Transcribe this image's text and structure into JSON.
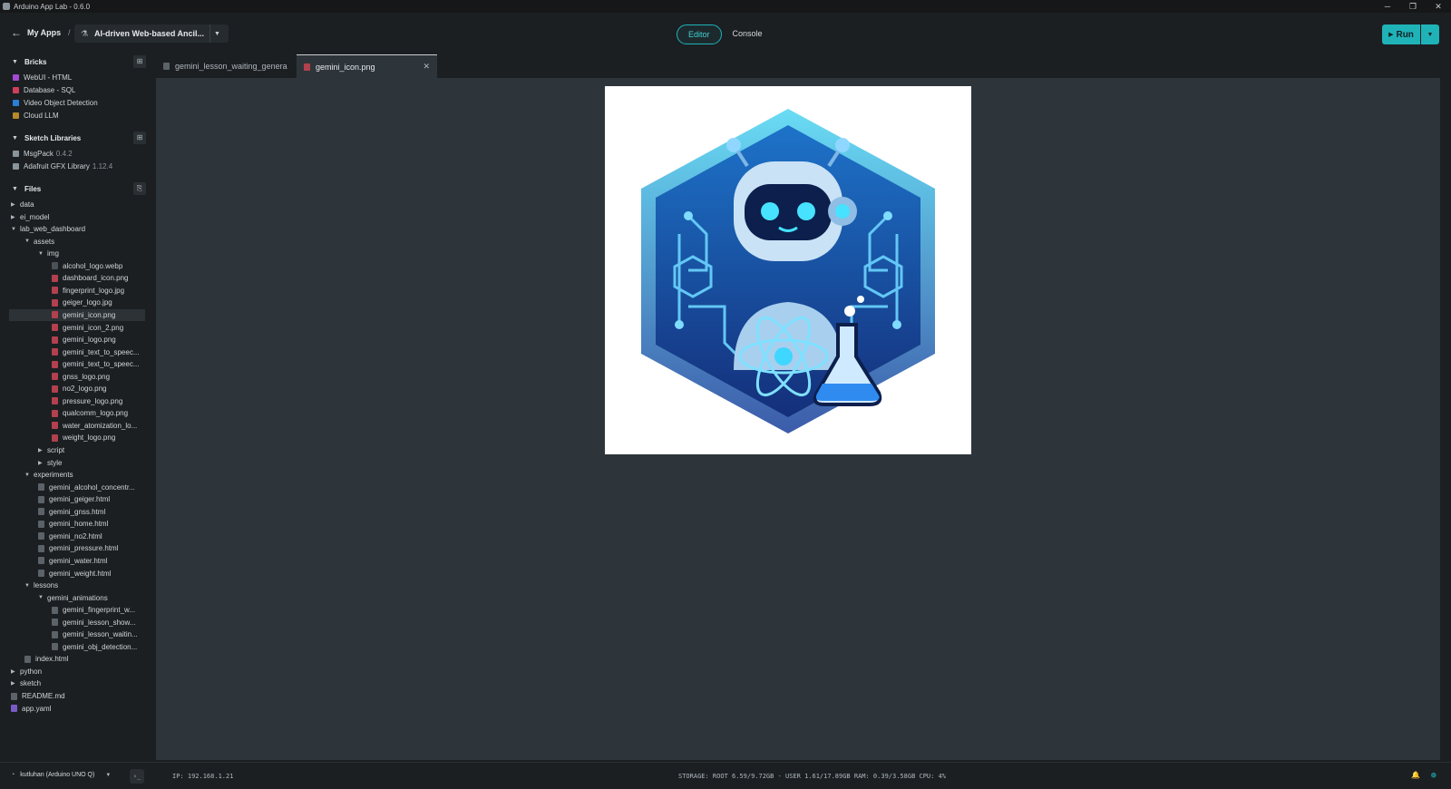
{
  "window": {
    "title": "Arduino App Lab - 0.6.0",
    "controls": [
      "─",
      "❐",
      "✕"
    ]
  },
  "header": {
    "back_label": "My Apps",
    "separator": "/",
    "app_name": "AI-driven Web-based Ancil...",
    "mode_tabs": [
      "Editor",
      "Console"
    ],
    "active_mode": "Editor",
    "run_label": "Run"
  },
  "sidebar": {
    "bricks": {
      "title": "Bricks",
      "items": [
        {
          "label": "WebUI - HTML",
          "color": "#a24ad3"
        },
        {
          "label": "Database - SQL",
          "color": "#d13e5b"
        },
        {
          "label": "Video Object Detection",
          "color": "#2a7fd6"
        },
        {
          "label": "Cloud LLM",
          "color": "#b8892a"
        }
      ]
    },
    "libraries": {
      "title": "Sketch Libraries",
      "items": [
        {
          "label": "MsgPack",
          "version": "0.4.2"
        },
        {
          "label": "Adafruit GFX Library",
          "version": "1.12.4"
        }
      ]
    },
    "files": {
      "title": "Files",
      "tree": [
        {
          "label": "data",
          "depth": 0,
          "kind": "folder",
          "open": false
        },
        {
          "label": "ei_model",
          "depth": 0,
          "kind": "folder",
          "open": false
        },
        {
          "label": "lab_web_dashboard",
          "depth": 0,
          "kind": "folder",
          "open": true
        },
        {
          "label": "assets",
          "depth": 1,
          "kind": "folder",
          "open": true
        },
        {
          "label": "img",
          "depth": 2,
          "kind": "folder",
          "open": true
        },
        {
          "label": "alcohol_logo.webp",
          "depth": 3,
          "kind": "file"
        },
        {
          "label": "dashboard_icon.png",
          "depth": 3,
          "kind": "img"
        },
        {
          "label": "fingerprint_logo.jpg",
          "depth": 3,
          "kind": "img"
        },
        {
          "label": "geiger_logo.jpg",
          "depth": 3,
          "kind": "img"
        },
        {
          "label": "gemini_icon.png",
          "depth": 3,
          "kind": "img",
          "selected": true
        },
        {
          "label": "gemini_icon_2.png",
          "depth": 3,
          "kind": "img"
        },
        {
          "label": "gemini_logo.png",
          "depth": 3,
          "kind": "img"
        },
        {
          "label": "gemini_text_to_speec...",
          "depth": 3,
          "kind": "img"
        },
        {
          "label": "gemini_text_to_speec...",
          "depth": 3,
          "kind": "img"
        },
        {
          "label": "gnss_logo.png",
          "depth": 3,
          "kind": "img"
        },
        {
          "label": "no2_logo.png",
          "depth": 3,
          "kind": "img"
        },
        {
          "label": "pressure_logo.png",
          "depth": 3,
          "kind": "img"
        },
        {
          "label": "qualcomm_logo.png",
          "depth": 3,
          "kind": "img"
        },
        {
          "label": "water_atomization_lo...",
          "depth": 3,
          "kind": "img"
        },
        {
          "label": "weight_logo.png",
          "depth": 3,
          "kind": "img"
        },
        {
          "label": "script",
          "depth": 2,
          "kind": "folder",
          "open": false
        },
        {
          "label": "style",
          "depth": 2,
          "kind": "folder",
          "open": false
        },
        {
          "label": "experiments",
          "depth": 1,
          "kind": "folder",
          "open": true
        },
        {
          "label": "gemini_alcohol_concentr...",
          "depth": 2,
          "kind": "html"
        },
        {
          "label": "gemini_geiger.html",
          "depth": 2,
          "kind": "html"
        },
        {
          "label": "gemini_gnss.html",
          "depth": 2,
          "kind": "html"
        },
        {
          "label": "gemini_home.html",
          "depth": 2,
          "kind": "html"
        },
        {
          "label": "gemini_no2.html",
          "depth": 2,
          "kind": "html"
        },
        {
          "label": "gemini_pressure.html",
          "depth": 2,
          "kind": "html"
        },
        {
          "label": "gemini_water.html",
          "depth": 2,
          "kind": "html"
        },
        {
          "label": "gemini_weight.html",
          "depth": 2,
          "kind": "html"
        },
        {
          "label": "lessons",
          "depth": 1,
          "kind": "folder",
          "open": true
        },
        {
          "label": "gemini_animations",
          "depth": 2,
          "kind": "folder",
          "open": true
        },
        {
          "label": "gemini_fingerprint_w...",
          "depth": 3,
          "kind": "html"
        },
        {
          "label": "gemini_lesson_show...",
          "depth": 3,
          "kind": "html"
        },
        {
          "label": "gemini_lesson_waitin...",
          "depth": 3,
          "kind": "html"
        },
        {
          "label": "gemini_obj_detection...",
          "depth": 3,
          "kind": "html"
        },
        {
          "label": "index.html",
          "depth": 1,
          "kind": "html"
        },
        {
          "label": "python",
          "depth": 0,
          "kind": "folder",
          "open": false
        },
        {
          "label": "sketch",
          "depth": 0,
          "kind": "folder",
          "open": false
        },
        {
          "label": "README.md",
          "depth": 0,
          "kind": "md"
        },
        {
          "label": "app.yaml",
          "depth": 0,
          "kind": "yaml"
        }
      ]
    }
  },
  "tabs": [
    {
      "label": "gemini_lesson_waiting_genera",
      "active": false
    },
    {
      "label": "gemini_icon.png",
      "active": true
    }
  ],
  "statusbar": {
    "board": "kutluhan (Arduino UNO Q)",
    "ip": "IP: 192.168.1.21",
    "stats": "STORAGE: ROOT 6.59/9.72GB - USER 1.61/17.89GB  RAM: 0.39/3.58GB  CPU: 4%"
  },
  "colors": {
    "accent": "#1fb3b8",
    "background": "#1b1f22",
    "editor": "#2e353a"
  }
}
